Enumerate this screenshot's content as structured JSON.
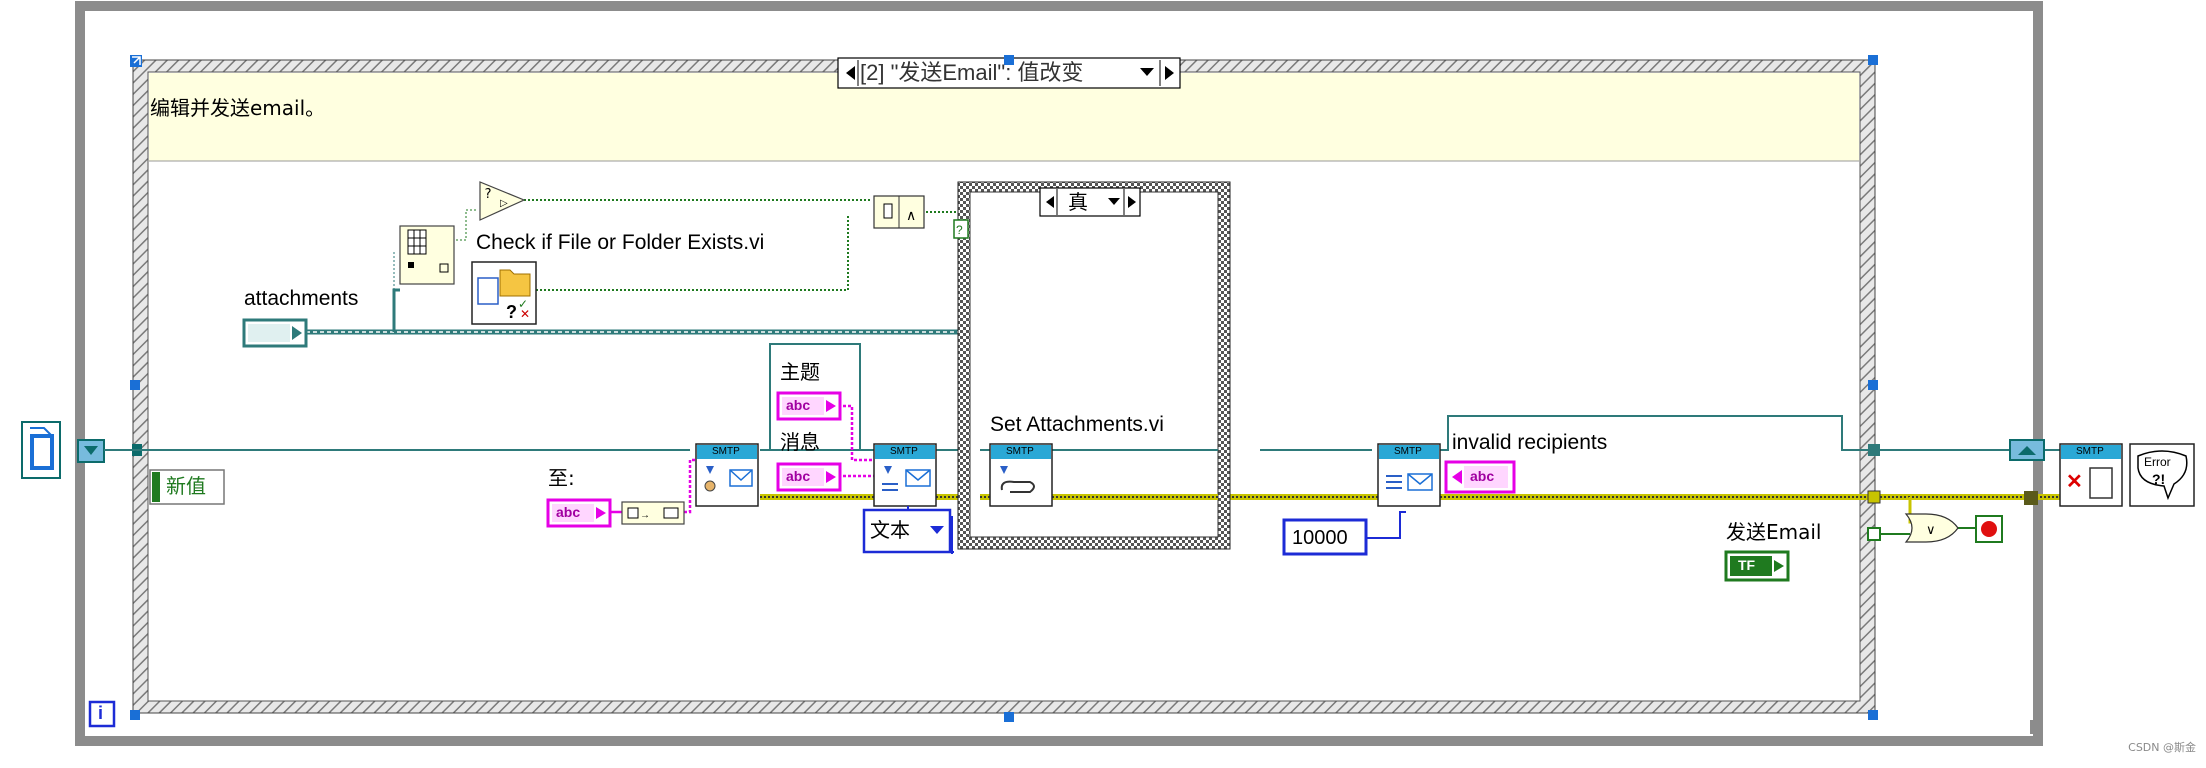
{
  "event_structure": {
    "selector_label": "[2] \"发送Email\": 值改变",
    "comment": "编辑并发送email。",
    "new_value_label": "新值"
  },
  "case_structure": {
    "selector_value": "真"
  },
  "labels": {
    "attachments": "attachments",
    "check_file_vi": "Check if File or Folder Exists.vi",
    "set_attachments_vi": "Set Attachments.vi",
    "to": "至:",
    "subject": "主题",
    "message": "消息",
    "text_enum": "文本",
    "invalid_recipients": "invalid recipients",
    "timeout_const": "10000",
    "send_email": "发送Email",
    "iteration": "i"
  },
  "icon_text": {
    "smtp": "SMTP",
    "abc": "abc",
    "tf": "TF",
    "error": "Error",
    "error_q": "?!"
  },
  "colors": {
    "frame_gray": "#8c8c8c",
    "hatch_dark": "#6f6f6f",
    "comment_bg": "#ffffe0",
    "refnum_wire": "#0c6b6b",
    "error_wire": "#c8c400",
    "path_wire": "#2e7a7a",
    "string_wire": "#e600e6",
    "bool_green": "#1f7a1f",
    "numeric_blue": "#1c2bd6",
    "smtp_blue": "#2aa8d6"
  },
  "watermark": "CSDN @斯金"
}
